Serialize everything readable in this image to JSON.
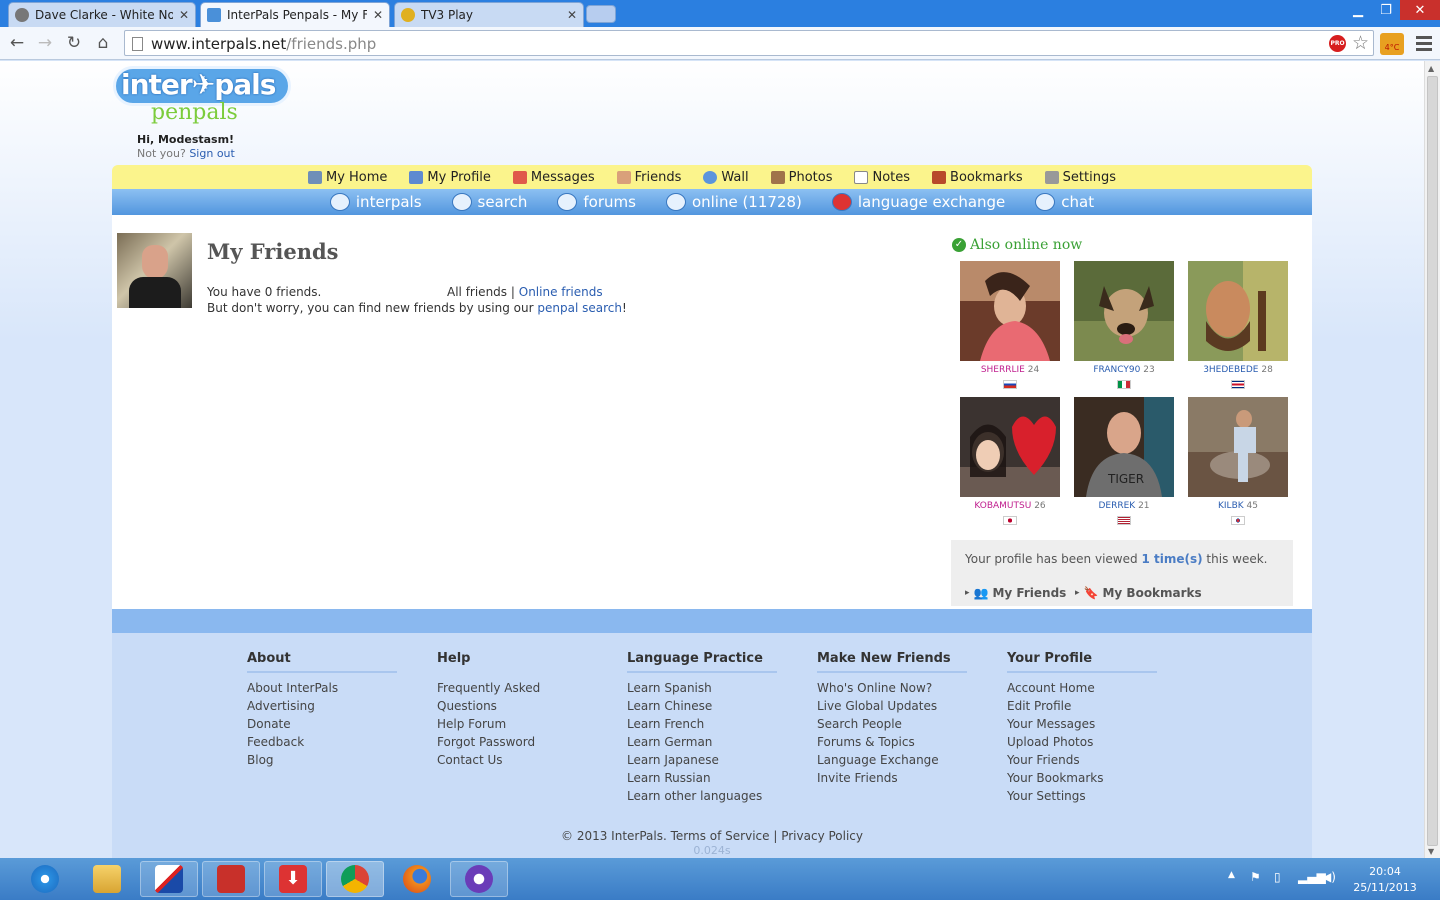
{
  "browser": {
    "tabs": [
      {
        "title": "Dave Clarke - White Noise"
      },
      {
        "title": "InterPals Penpals - My Frie"
      },
      {
        "title": "TV3 Play"
      }
    ],
    "url_host": "www.interpals.net",
    "url_path": "/friends.php"
  },
  "site": {
    "logo_top": "inter",
    "logo_mid": "pals",
    "logo_bottom": "penpals",
    "greeting": "Hi, Modestasm!",
    "not_you": "Not you?",
    "sign_out": "Sign out"
  },
  "topnav": [
    "My Home",
    "My Profile",
    "Messages",
    "Friends",
    "Wall",
    "Photos",
    "Notes",
    "Bookmarks",
    "Settings"
  ],
  "subnav": [
    "interpals",
    "search",
    "forums",
    "online (11728)",
    "language exchange",
    "chat"
  ],
  "main": {
    "title": "My Friends",
    "count_text": "You have 0 friends.",
    "filter_all": "All friends",
    "filter_sep": "|",
    "filter_online": "Online friends",
    "hint_before": "But don't worry, you can find new friends by using our",
    "hint_link": "penpal search",
    "hint_after": "!"
  },
  "online_now": {
    "title": "Also online now",
    "people": [
      {
        "name": "SHERRLIE",
        "age": "24",
        "gender": "f",
        "flag": "ru"
      },
      {
        "name": "FRANCY90",
        "age": "23",
        "gender": "m",
        "flag": "it"
      },
      {
        "name": "3HEDEBEDE",
        "age": "28",
        "gender": "m",
        "flag": "cr"
      },
      {
        "name": "KOBAMUTSU",
        "age": "26",
        "gender": "f",
        "flag": "jp"
      },
      {
        "name": "DERREK",
        "age": "21",
        "gender": "m",
        "flag": "us"
      },
      {
        "name": "KILBK",
        "age": "45",
        "gender": "m",
        "flag": "kr"
      }
    ]
  },
  "views": {
    "prefix": "Your profile has been viewed",
    "count": "1 time(s)",
    "suffix": "this week.",
    "my_friends": "My Friends",
    "my_bookmarks": "My Bookmarks"
  },
  "footer": {
    "columns": [
      {
        "title": "About",
        "links": [
          "About InterPals",
          "Advertising",
          "Donate",
          "Feedback",
          "Blog"
        ]
      },
      {
        "title": "Help",
        "links": [
          "Frequently Asked Questions",
          "Help Forum",
          "Forgot Password",
          "Contact Us"
        ]
      },
      {
        "title": "Language Practice",
        "links": [
          "Learn Spanish",
          "Learn Chinese",
          "Learn French",
          "Learn German",
          "Learn Japanese",
          "Learn Russian",
          "Learn other languages"
        ]
      },
      {
        "title": "Make New Friends",
        "links": [
          "Who's Online Now?",
          "Live Global Updates",
          "Search People",
          "Forums & Topics",
          "Language Exchange",
          "Invite Friends"
        ]
      },
      {
        "title": "Your Profile",
        "links": [
          "Account Home",
          "Edit Profile",
          "Your Messages",
          "Upload Photos",
          "Your Friends",
          "Your Bookmarks",
          "Your Settings"
        ]
      }
    ],
    "copyright": "© 2013 InterPals.",
    "terms": "Terms of Service",
    "sep": "|",
    "privacy": "Privacy Policy",
    "timing": "0.024s"
  },
  "taskbar": {
    "time": "20:04",
    "date": "25/11/2013"
  },
  "colors": {
    "accent_blue": "#2a5db0",
    "online_green": "#3aa135",
    "female_name": "#c0208f",
    "nav_yellow": "#fbf48c"
  }
}
